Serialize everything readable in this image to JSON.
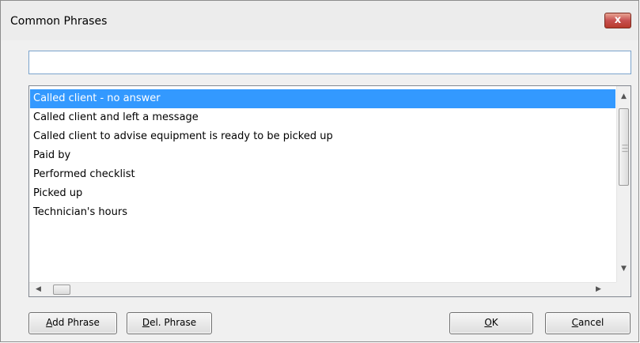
{
  "window": {
    "title": "Common Phrases",
    "close_symbol": "x"
  },
  "search": {
    "value": "",
    "placeholder": ""
  },
  "phrases": {
    "items": [
      {
        "label": "Called client - no answer",
        "selected": true
      },
      {
        "label": "Called client and left a message",
        "selected": false
      },
      {
        "label": "Called client to advise equipment is ready to be picked up",
        "selected": false
      },
      {
        "label": "Paid by",
        "selected": false
      },
      {
        "label": "Performed checklist",
        "selected": false
      },
      {
        "label": "Picked up",
        "selected": false
      },
      {
        "label": "Technician's hours",
        "selected": false
      }
    ],
    "selection_color": "#3399ff"
  },
  "buttons": {
    "add_phrase": {
      "accel": "A",
      "rest": "dd Phrase"
    },
    "del_phrase": {
      "accel": "D",
      "rest": "el. Phrase"
    },
    "ok": {
      "accel": "O",
      "rest": "K"
    },
    "cancel": {
      "accel": "C",
      "rest": "ancel"
    }
  },
  "icons": {
    "close": "close-icon",
    "scroll_up": "scroll-up-arrow-icon",
    "scroll_down": "scroll-down-arrow-icon",
    "scroll_left": "scroll-left-arrow-icon",
    "scroll_right": "scroll-right-arrow-icon"
  }
}
